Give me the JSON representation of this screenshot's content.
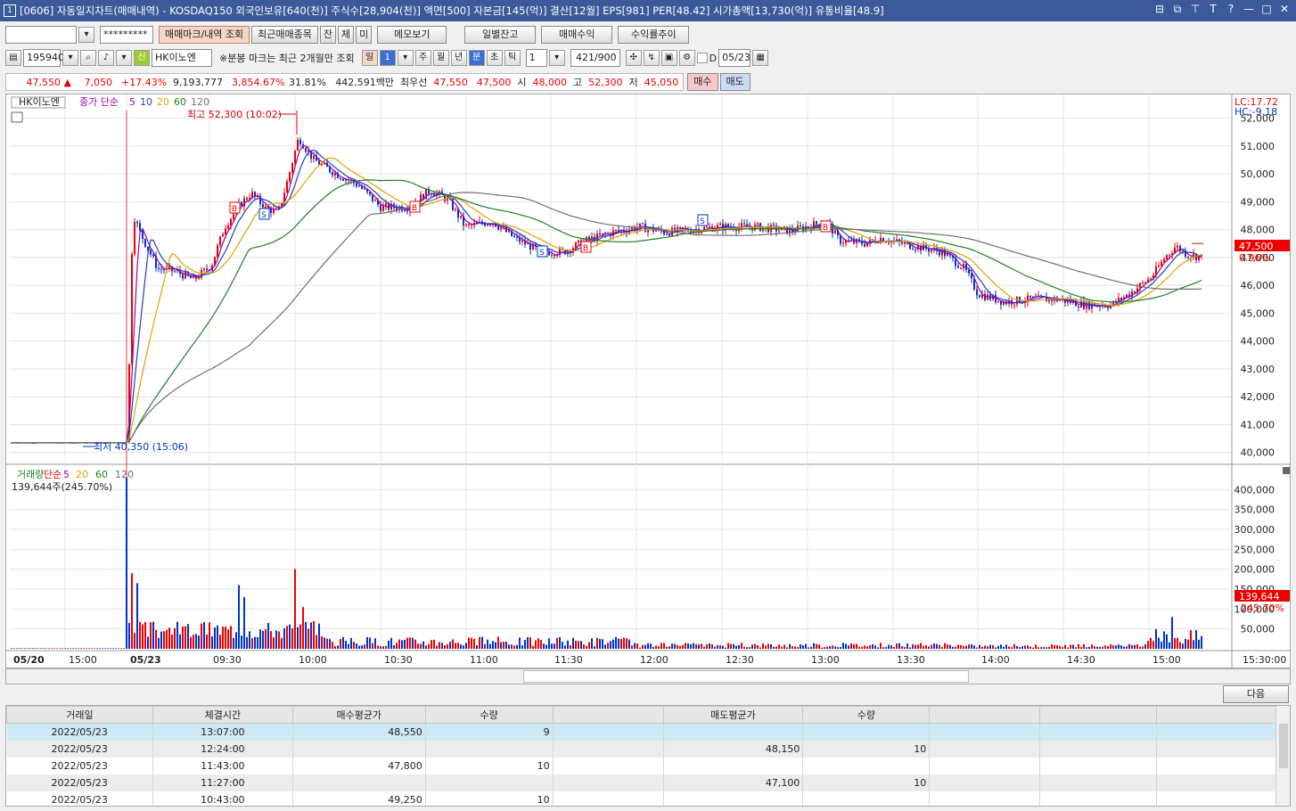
{
  "window": {
    "title": "[0606] 자동일지차트(매매내역) - KOSDAQ150 외국인보유[640(천)] 주식수[28,904(천)] 액면[500] 자본금[145(억)] 결산[12월] EPS[981] PER[48.42] 시가총액[13,730(억)] 유통비율[48.9]",
    "icon": "1"
  },
  "toolbar1": {
    "account": "",
    "password": "*********",
    "buttons": [
      "매매마크/내역 조회",
      "최근매매종목",
      "잔",
      "체",
      "미",
      "메모보기"
    ],
    "right_buttons": [
      "일별잔고",
      "매매수익",
      "수익률추이"
    ]
  },
  "toolbar2": {
    "code": "195940",
    "sin": "신",
    "name": "HK이노엔",
    "note": "※분봉 마크는 최근 2개월만 조회",
    "periods": [
      "일",
      "1",
      "주",
      "월",
      "년",
      "분",
      "초",
      "틱"
    ],
    "tick_value": "1",
    "count": "421/900",
    "d_label": "D",
    "date": "05/23"
  },
  "quote": {
    "price": "47,550 ▲",
    "change": "7,050",
    "change_pct": "+17.43%",
    "volume": "9,193,777",
    "vol_pct": "3,854.67%",
    "turnover": "31.81%",
    "amount": "442,591백만",
    "best_label": "최우선",
    "bid": "47,550",
    "ask": "47,500",
    "open_label": "시",
    "open": "48,000",
    "high_label": "고",
    "high": "52,300",
    "low_label": "저",
    "low": "45,050",
    "buy": "매수",
    "sell": "매도"
  },
  "chart": {
    "legend": [
      "HK이노엔",
      "종가 단순",
      "5",
      "10",
      "20",
      "60",
      "120"
    ],
    "high_note": "최고 52,300 (10:02)",
    "low_note": "최저 40,350 (15:06)",
    "lc": "LC:17.72",
    "hc": "HC:-9.18",
    "price_badge": "47,500",
    "price_pct": "0.96%",
    "y_ticks": [
      "52,000",
      "51,000",
      "50,000",
      "49,000",
      "48,000",
      "47,000",
      "46,000",
      "45,000",
      "44,000",
      "43,000",
      "42,000",
      "41,000",
      "40,000"
    ],
    "vol_legend": [
      "거래량",
      "단순",
      "5",
      "20",
      "60",
      "120"
    ],
    "vol_value": "139,644주(245.70%)",
    "vol_ticks": [
      "400,000",
      "350,000",
      "300,000",
      "250,000",
      "200,000",
      "150,000",
      "100,000",
      "50,000"
    ],
    "vol_badge": "139,644",
    "vol_badge_pct": "245.70%",
    "x_ticks": [
      "05/20",
      "15:00",
      "05/23",
      "09:30",
      "10:00",
      "10:30",
      "11:00",
      "11:30",
      "12:00",
      "12:30",
      "13:00",
      "13:30",
      "14:00",
      "14:30",
      "15:00",
      "15:30:00"
    ],
    "markers": [
      "B",
      "S",
      "B",
      "S",
      "B",
      "S",
      "B"
    ]
  },
  "next_button": "다음",
  "table": {
    "headers": [
      "거래일",
      "체결시간",
      "매수평균가",
      "수량",
      "",
      "매도평균가",
      "수량",
      "",
      "",
      ""
    ],
    "rows": [
      [
        "2022/05/23",
        "13:07:00",
        "48,550",
        "9",
        "",
        "",
        "",
        "",
        "",
        ""
      ],
      [
        "2022/05/23",
        "12:24:00",
        "",
        "",
        "",
        "48,150",
        "10",
        "",
        "",
        ""
      ],
      [
        "2022/05/23",
        "11:43:00",
        "47,800",
        "10",
        "",
        "",
        "",
        "",
        "",
        ""
      ],
      [
        "2022/05/23",
        "11:27:00",
        "",
        "",
        "",
        "47,100",
        "10",
        "",
        "",
        ""
      ],
      [
        "2022/05/23",
        "10:43:00",
        "49,250",
        "10",
        "",
        "",
        "",
        "",
        "",
        ""
      ]
    ]
  }
}
